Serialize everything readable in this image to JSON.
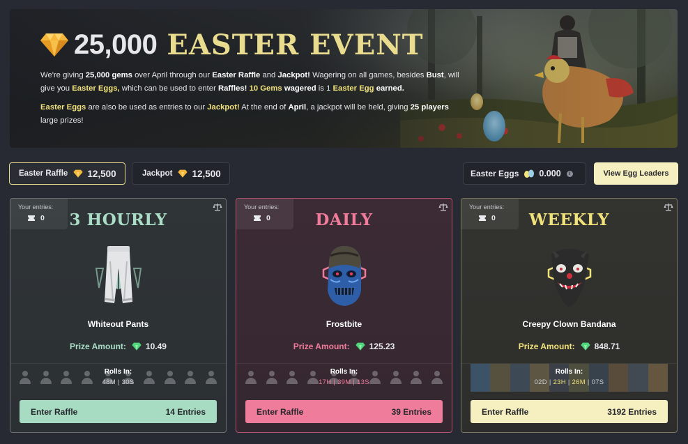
{
  "banner": {
    "amount": "25,000",
    "event_title": "EASTER EVENT",
    "p1": {
      "t1": "We're giving ",
      "b1": "25,000 gems",
      "t2": " over April through our ",
      "b2": "Easter Raffle",
      "t3": " and ",
      "b3": "Jackpot!",
      "t4": " Wagering on all games, besides ",
      "b4": "Bust",
      "t5": ", will give you ",
      "y1": "Easter Eggs,",
      "t6": " which can be used to enter ",
      "b5": "Raffles!",
      "t7": " ",
      "y2": "10 Gems",
      "t8": " ",
      "b6": "wagered",
      "t9": " is 1 ",
      "y3": "Easter Egg",
      "t10": " ",
      "b7": "earned."
    },
    "p2": {
      "y1": "Easter Eggs",
      "t1": " are also be used as entries to our ",
      "y2": "Jackpot!",
      "t2": " At the end of ",
      "b1": "April",
      "t3": ", a jackpot will be held, giving ",
      "b2": "25 players",
      "t4": " large prizes!"
    }
  },
  "toolbar": {
    "raffle_label": "Easter Raffle",
    "raffle_value": "12,500",
    "jackpot_label": "Jackpot",
    "jackpot_value": "12,500",
    "eggs_label": "Easter Eggs",
    "eggs_value": "0.000",
    "leaders_button": "View Egg Leaders"
  },
  "cards": [
    {
      "entries_label": "Your entries:",
      "entries_count": "0",
      "title": "3 HOURLY",
      "item_name": "Whiteout Pants",
      "prize_label": "Prize Amount:",
      "prize_value": "10.49",
      "rolls_label": "Rolls In:",
      "rolls_time": "48M | 30S",
      "enter_label": "Enter Raffle",
      "entries_total": "14 Entries"
    },
    {
      "entries_label": "Your entries:",
      "entries_count": "0",
      "title": "DAILY",
      "item_name": "Frostbite",
      "prize_label": "Prize Amount:",
      "prize_value": "125.23",
      "rolls_label": "Rolls In:",
      "rolls_time": "17H | 39M | 13S",
      "enter_label": "Enter Raffle",
      "entries_total": "39 Entries"
    },
    {
      "entries_label": "Your entries:",
      "entries_count": "0",
      "title": "WEEKLY",
      "item_name": "Creepy Clown Bandana",
      "prize_label": "Prize Amount:",
      "prize_value": "848.71",
      "rolls_label": "Rolls In:",
      "rolls_d": "02D",
      "rolls_sep1": " | ",
      "rolls_h": "23H",
      "rolls_sep2": " | ",
      "rolls_m": "26M",
      "rolls_sep3": " | ",
      "rolls_s": "07S",
      "enter_label": "Enter Raffle",
      "entries_total": "3192 Entries"
    }
  ],
  "colors": {
    "background": "#272a33",
    "gold": "#f2e27b",
    "mint": "#a9ddc6",
    "pink": "#f07c9b",
    "cream": "#f6efbf"
  },
  "icons": [
    "diamond-gem-icon",
    "green-gem-icon",
    "ticket-icon",
    "scale-icon",
    "eggs-icon",
    "info-icon",
    "user-avatar-icon"
  ]
}
